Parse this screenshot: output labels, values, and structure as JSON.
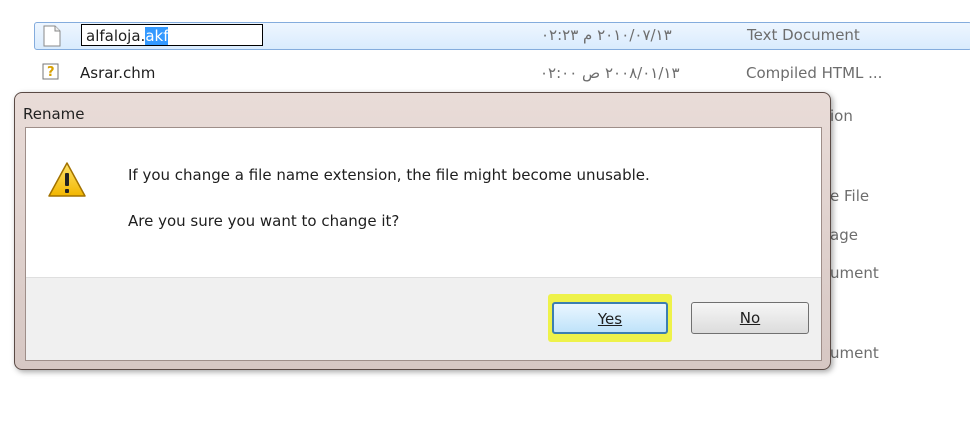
{
  "files": [
    {
      "name_before_ext": "alfaloja.",
      "name_ext": "akf",
      "date": "٢٠١٠/٠٧/١٣ م ٠٢:٢٣",
      "type": "Text Document"
    },
    {
      "name": "Asrar.chm",
      "date": "٢٠٠٨/٠١/١٣ ص ٠٢:٠٠",
      "type": "Compiled HTML ..."
    },
    {
      "type_partial": "ion"
    },
    {
      "type_partial": "e File"
    },
    {
      "type_partial": "age"
    },
    {
      "type_partial": "ument"
    },
    {
      "type_partial": "ument"
    }
  ],
  "dialog": {
    "title": "Rename",
    "message": "If you change a file name extension, the file might become unusable.",
    "question": "Are you sure you want to change it?",
    "yes_label": "Yes",
    "no_label": "No"
  }
}
